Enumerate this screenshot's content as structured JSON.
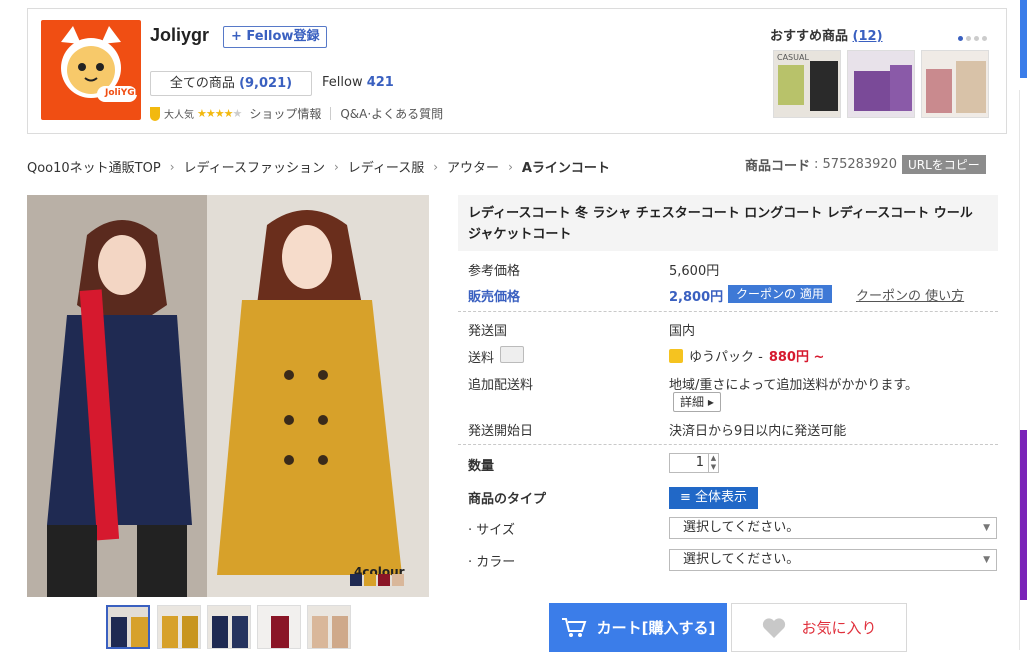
{
  "shop": {
    "logo_text": "JoliYGR",
    "name": "Joliygr",
    "fellow_register": "+ Fellow登録",
    "all_items_label": "全ての商品",
    "all_items_count": "(9,021)",
    "fellow_label": "Fellow",
    "fellow_count": "421",
    "rank_label": "大人気",
    "rating_stars": 4,
    "shop_info": "ショップ情報",
    "qa": "Q&A·よくある質問"
  },
  "recommend": {
    "title": "おすすめ商品",
    "count": "(12)",
    "thumb_text": "CASUAL"
  },
  "breadcrumb": {
    "items": [
      "Qoo10ネット通販TOP",
      "レディースファッション",
      "レディース服",
      "アウター",
      "Aラインコート"
    ]
  },
  "product_code": {
    "label": "商品コード",
    "value": ": 575283920",
    "copy_label": "URLをコピー"
  },
  "image": {
    "colour_label": "4colour",
    "swatch_colors": [
      "#1f2a52",
      "#d7a12a",
      "#8a1526",
      "#d9b79a"
    ]
  },
  "product": {
    "title": "レディースコート 冬 ラシャ チェスターコート ロングコート レディースコート ウール ジャケットコート",
    "ref_price_label": "参考価格",
    "ref_price": "5,600円",
    "sale_price_label": "販売価格",
    "sale_price": "2,800円",
    "coupon_badge": "クーポンの 適用",
    "coupon_link": "クーポンの 使い方",
    "ship_country_label": "発送国",
    "ship_country": "国内",
    "shipping_label": "送料",
    "shipping_method": "ゆうパック -",
    "shipping_fee": "880円 ~",
    "extra_ship_label": "追加配送料",
    "extra_ship_text": "地域/重さによって追加送料がかかります。",
    "detail_btn": "詳細 ▸",
    "ship_start_label": "発送開始日",
    "ship_start": "決済日から9日以内に発送可能",
    "qty_label": "数量",
    "qty_value": "1",
    "type_label": "商品のタイプ",
    "view_all": "≡ 全体表示",
    "size_label": "· サイズ",
    "color_label": "· カラー",
    "select_placeholder": "選択してください。"
  },
  "actions": {
    "cart": "カート[購入する]",
    "favorite": "お気に入り"
  },
  "colors": {
    "accent_blue": "#3a60c0",
    "cart_blue": "#3b7de9",
    "price_red": "#d6192e",
    "logo_orange": "#f04e13"
  }
}
